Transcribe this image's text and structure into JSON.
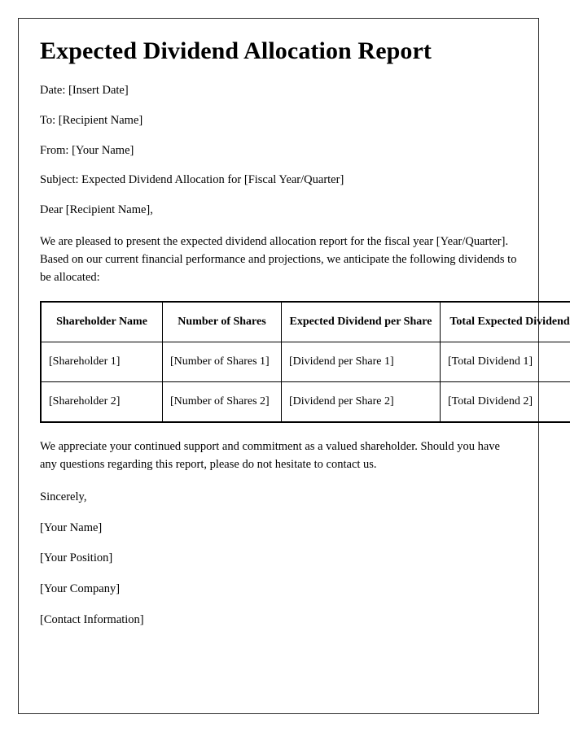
{
  "document": {
    "title": "Expected Dividend Allocation Report",
    "meta": {
      "date_line": "Date: [Insert Date]",
      "to_line": "To: [Recipient Name]",
      "from_line": "From: [Your Name]",
      "subject_line": "Subject: Expected Dividend Allocation for [Fiscal Year/Quarter]"
    },
    "salutation": "Dear [Recipient Name],",
    "intro_paragraph": "We are pleased to present the expected dividend allocation report for the fiscal year [Year/Quarter]. Based on our current financial performance and projections, we anticipate the following dividends to be allocated:",
    "closing_paragraph": "We appreciate your continued support and commitment as a valued shareholder. Should you have any questions regarding this report, please do not hesitate to contact us.",
    "signature": {
      "sign_off": "Sincerely,",
      "name": "[Your Name]",
      "position": "[Your Position]",
      "company": "[Your Company]",
      "contact": "[Contact Information]"
    }
  },
  "table": {
    "headers": [
      "Shareholder Name",
      "Number of Shares",
      "Expected Dividend per Share",
      "Total Expected Dividend"
    ],
    "rows": [
      {
        "shareholder_name": "[Shareholder 1]",
        "number_of_shares": "[Number of Shares 1]",
        "dividend_per_share": "[Dividend per Share 1]",
        "total_dividend": "[Total Dividend 1]"
      },
      {
        "shareholder_name": "[Shareholder 2]",
        "number_of_shares": "[Number of Shares 2]",
        "dividend_per_share": "[Dividend per Share 2]",
        "total_dividend": "[Total Dividend 2]"
      }
    ]
  },
  "colors": {
    "text": "#000000",
    "page_background": "#ffffff",
    "frame_border": "#2b2b2b",
    "table_border": "#000000"
  }
}
